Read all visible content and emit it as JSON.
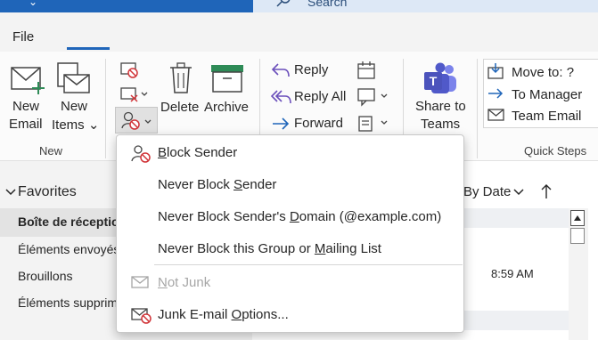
{
  "titlebar": {
    "search_placeholder": "Search"
  },
  "menu": {
    "file_label": "File"
  },
  "ribbon": {
    "new_email": [
      "New",
      "Email"
    ],
    "new_items": [
      "New",
      "Items ⌄"
    ],
    "group_new": "New",
    "delete": "Delete",
    "archive": "Archive",
    "reply": "Reply",
    "reply_all": "Reply All",
    "forward": "Forward",
    "share_teams": [
      "Share to",
      "Teams"
    ],
    "quick_steps": [
      "Move to: ?",
      "To Manager",
      "Team Email"
    ],
    "group_quick_steps": "Quick Steps"
  },
  "favorites": {
    "header": "Favorites",
    "items": [
      "Boîte de réception",
      "Éléments envoyés",
      "Brouillons",
      "Éléments supprimés"
    ]
  },
  "message_list": {
    "sort_label": "By Date",
    "time": "8:59 AM"
  },
  "junk_menu": {
    "items": [
      {
        "pre": "",
        "u": "B",
        "post": "lock Sender",
        "enabled": true
      },
      {
        "pre": "Never Block ",
        "u": "S",
        "post": "ender",
        "enabled": true
      },
      {
        "pre": "Never Block Sender's ",
        "u": "D",
        "post": "omain (@example.com)",
        "enabled": true
      },
      {
        "pre": "Never Block this Group or ",
        "u": "M",
        "post": "ailing List",
        "enabled": true
      },
      {
        "pre": "",
        "u": "N",
        "post": "ot Junk",
        "enabled": false
      },
      {
        "pre": "Junk E-mail ",
        "u": "O",
        "post": "ptions...",
        "enabled": true
      }
    ]
  },
  "colors": {
    "accent": "#1f65b9",
    "green": "#2e8b57",
    "purple": "#6b4fbb",
    "red": "#d13438"
  }
}
